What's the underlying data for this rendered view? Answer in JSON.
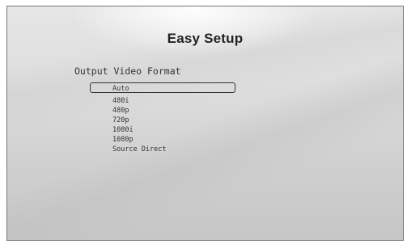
{
  "header": {
    "title": "Easy Setup"
  },
  "section": {
    "heading": "Output Video Format"
  },
  "options": [
    {
      "label": "Auto",
      "selected": true
    },
    {
      "label": "480i",
      "selected": false
    },
    {
      "label": "480p",
      "selected": false
    },
    {
      "label": "720p",
      "selected": false
    },
    {
      "label": "1080i",
      "selected": false
    },
    {
      "label": "1080p",
      "selected": false
    },
    {
      "label": "Source Direct",
      "selected": false
    }
  ]
}
